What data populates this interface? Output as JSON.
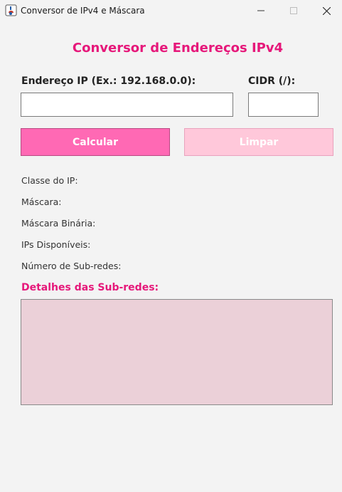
{
  "window": {
    "title": "Conversor de IPv4 e Máscara",
    "icons": {
      "app": "java-app-icon",
      "minimize": "minimize-icon",
      "maximize": "maximize-icon",
      "close": "close-icon"
    }
  },
  "main": {
    "heading": "Conversor de Endereços IPv4",
    "ip_label": "Endereço IP (Ex.: 192.168.0.0):",
    "ip_value": "",
    "cidr_label": "CIDR (/):",
    "cidr_value": "",
    "calculate_label": "Calcular",
    "clear_label": "Limpar",
    "results": {
      "class_label": "Classe do IP:",
      "mask_label": "Máscara:",
      "binary_mask_label": "Máscara Binária:",
      "available_ips_label": "IPs Disponíveis:",
      "subnet_count_label": "Número de Sub-redes:"
    },
    "subnets_title": "Detalhes das Sub-redes:",
    "subnets_text": ""
  },
  "colors": {
    "accent": "#e6187a",
    "calculate_bg": "#ff69b4",
    "clear_bg": "#ffc8da",
    "subnets_bg": "#ebd0d8"
  }
}
